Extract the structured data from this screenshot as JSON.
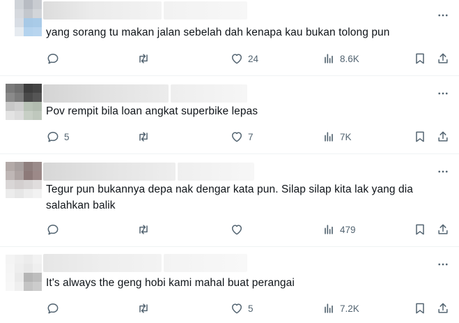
{
  "replies": [
    {
      "text": "yang sorang tu makan jalan sebelah dah kenapa kau bukan tolong pun",
      "replies_count": "",
      "reposts_count": "",
      "likes_count": "24",
      "views_count": "8.6K"
    },
    {
      "text": "Pov rempit bila loan angkat superbike lepas",
      "replies_count": "5",
      "reposts_count": "",
      "likes_count": "7",
      "views_count": "7K"
    },
    {
      "text": "Tegur pun bukannya depa nak dengar kata pun. Silap silap kita lak yang dia salahkan balik",
      "replies_count": "",
      "reposts_count": "",
      "likes_count": "",
      "views_count": "479"
    },
    {
      "text": "It's always the geng hobi kami mahal buat perangai",
      "replies_count": "",
      "reposts_count": "",
      "likes_count": "5",
      "views_count": "7.2K"
    }
  ],
  "icons": {
    "reply": "reply-bubble-icon",
    "repost": "repost-arrows-icon",
    "like": "heart-icon",
    "views": "views-bar-chart-icon",
    "bookmark": "bookmark-icon",
    "share": "share-upload-icon",
    "more": "more-horizontal-icon"
  },
  "colors": {
    "text": "#0f1419",
    "secondary": "#536471",
    "divider": "#eff3f4"
  }
}
